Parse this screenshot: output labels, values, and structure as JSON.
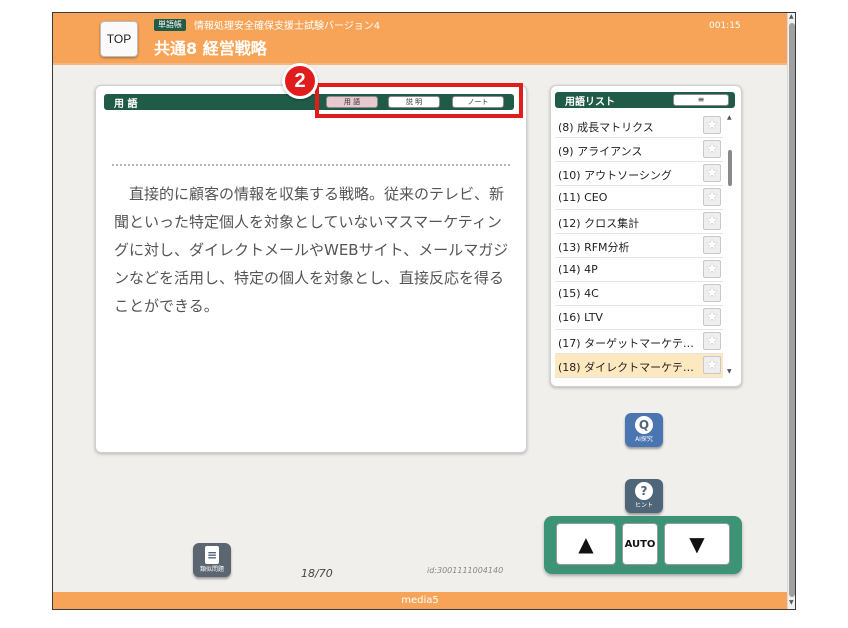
{
  "header": {
    "top_label": "TOP",
    "badge": "単語帳",
    "subtitle": "情報処理安全確保支援士試験バージョン4",
    "title": "共通8 経営戦略",
    "timer": "001:15"
  },
  "main": {
    "head_label": "用 語",
    "tabs": [
      {
        "label": "用 語",
        "active": true
      },
      {
        "label": "説 明",
        "active": false
      },
      {
        "label": "ノート",
        "active": false
      }
    ],
    "definition": "直接的に顧客の情報を収集する戦略。従来のテレビ、新聞といった特定個人を対象としていないマスマーケティングに対し、ダイレクトメールやWEBサイト、メールマガジンなどを活用し、特定の個人を対象とし、直接反応を得ることができる。",
    "marker": "2"
  },
  "term_list": {
    "title": "用語リスト",
    "menu_label": "≡",
    "items": [
      {
        "label": "(8) 成長マトリクス",
        "selected": false
      },
      {
        "label": "(9) アライアンス",
        "selected": false
      },
      {
        "label": "(10) アウトソーシング",
        "selected": false
      },
      {
        "label": "(11) CEO",
        "selected": false
      },
      {
        "label": "(12) クロス集計",
        "selected": false
      },
      {
        "label": "(13) RFM分析",
        "selected": false
      },
      {
        "label": "(14) 4P",
        "selected": false
      },
      {
        "label": "(15) 4C",
        "selected": false
      },
      {
        "label": "(16) LTV",
        "selected": false
      },
      {
        "label": "(17) ターゲットマーケテ…",
        "selected": false
      },
      {
        "label": "(18) ダイレクトマーケテ…",
        "selected": true
      }
    ],
    "star_icon": "★"
  },
  "buttons": {
    "ai_label": "AI探究",
    "hint_label": "ヒント",
    "similar_label": "類似問題",
    "auto_label": "AUTO",
    "up_icon": "▲",
    "down_icon": "▼"
  },
  "status": {
    "page": "18/70",
    "term_id": "id:3001111004140"
  },
  "footer": {
    "label": "media5"
  }
}
